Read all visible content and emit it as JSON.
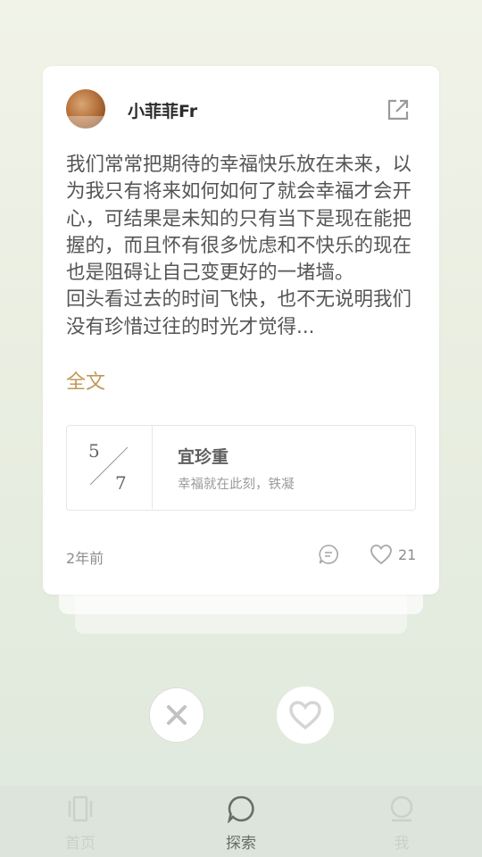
{
  "post": {
    "username": "小菲菲Fr",
    "body": "我们常常把期待的幸福快乐放在未来，以为我只有将来如何如何了就会幸福才会开心，可结果是未知的只有当下是现在能把握的，而且怀有很多忧虑和不快乐的现在也是阻碍让自己变更好的一堵墙。\n回头看过去的时间飞快，也不无说明我们没有珍惜过往的时光才觉得...",
    "fulltext_link": "全文",
    "time_ago": "2年前",
    "like_count": "21"
  },
  "quote_card": {
    "day": "5",
    "month": "7",
    "title": "宜珍重",
    "subtitle": "幸福就在此刻，铁凝"
  },
  "tabs": [
    {
      "label": "首页",
      "icon": "home-cards-icon",
      "active": false
    },
    {
      "label": "探索",
      "icon": "explore-bubble-icon",
      "active": true
    },
    {
      "label": "我",
      "icon": "profile-icon",
      "active": false
    }
  ],
  "colors": {
    "accent_link": "#c09a5a",
    "background_top": "#f1f3e8",
    "background_bottom": "#dfe9dd",
    "tabbar": "#dce4db"
  }
}
